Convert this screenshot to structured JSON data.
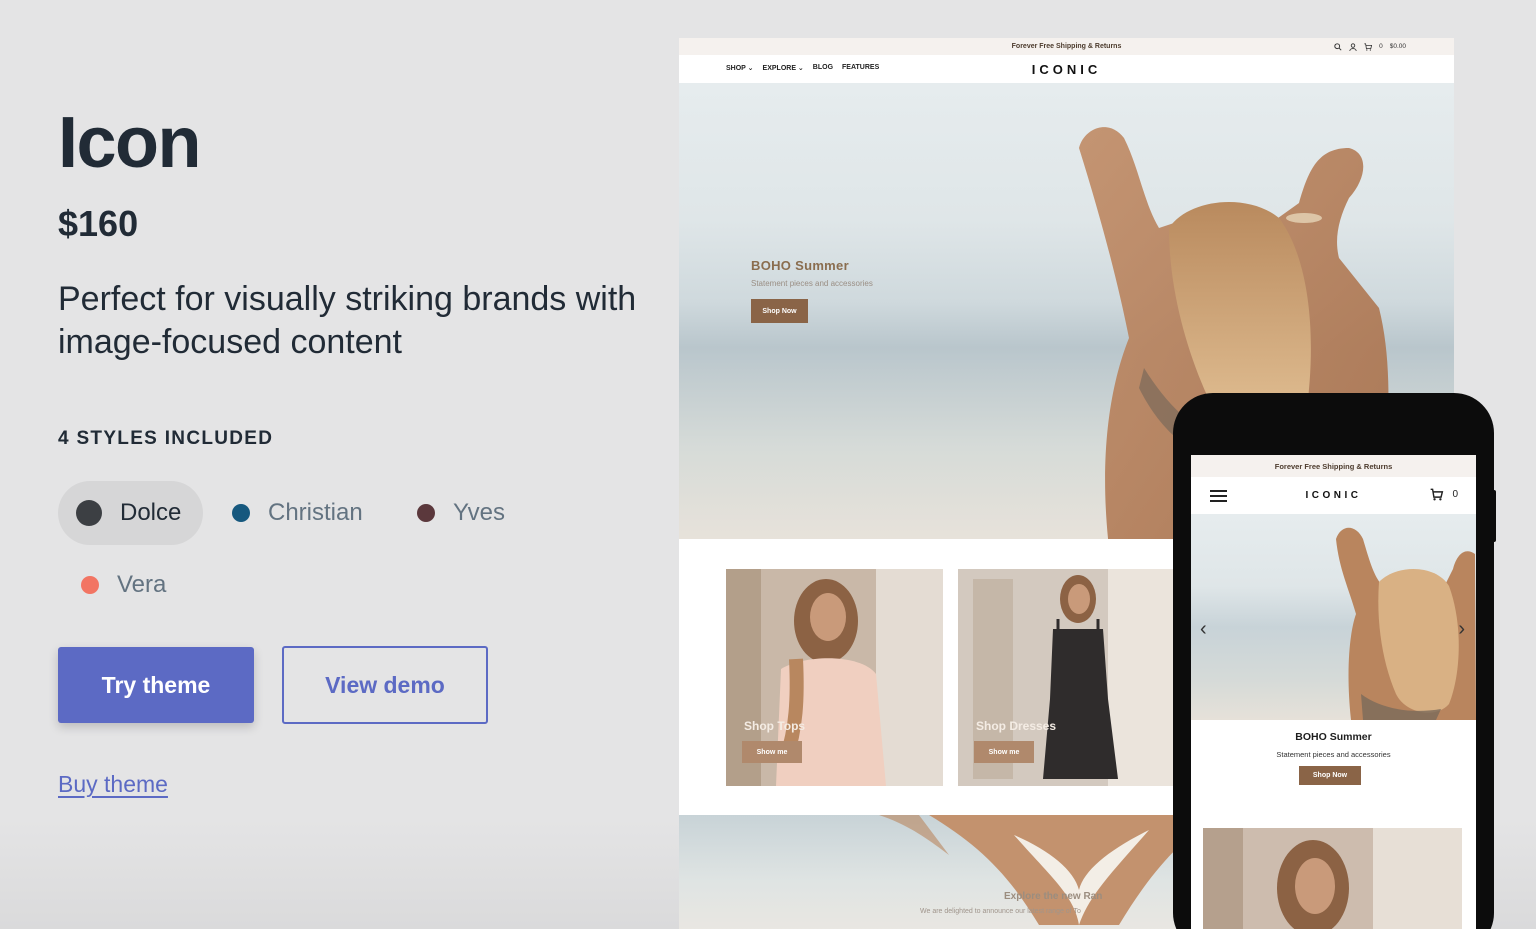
{
  "theme": {
    "name": "Icon",
    "price": "$160",
    "description": "Perfect for visually striking brands with image-focused content",
    "styles_heading": "4 STYLES INCLUDED",
    "styles": [
      {
        "label": "Dolce",
        "color": "#3c3f43",
        "selected": true
      },
      {
        "label": "Christian",
        "color": "#16587e",
        "selected": false
      },
      {
        "label": "Yves",
        "color": "#5b383c",
        "selected": false
      },
      {
        "label": "Vera",
        "color": "#f27563",
        "selected": false
      }
    ],
    "try_label": "Try theme",
    "demo_label": "View demo",
    "buy_label": "Buy theme",
    "accent_color": "#5c6ac4"
  },
  "desktop_preview": {
    "announcement": "Forever Free Shipping & Returns",
    "cart_count": "0",
    "cart_total": "$0.00",
    "nav": [
      "SHOP",
      "EXPLORE",
      "BLOG",
      "FEATURES"
    ],
    "logo": "ICONIC",
    "hero": {
      "title": "BOHO Summer",
      "subtitle": "Statement pieces and accessories",
      "button": "Shop Now"
    },
    "cards": [
      {
        "label": "Shop Tops",
        "button": "Show me"
      },
      {
        "label": "Shop Dresses",
        "button": "Show me"
      }
    ],
    "bottom": {
      "title": "Explore the new Ran",
      "subtitle": "We are delighted to announce our latest range of To"
    }
  },
  "mobile_preview": {
    "announcement": "Forever Free Shipping & Returns",
    "logo": "ICONIC",
    "cart_count": "0",
    "hero_title": "BOHO Summer",
    "hero_subtitle": "Statement pieces and accessories",
    "hero_button": "Shop Now",
    "arrow_prev": "‹",
    "arrow_next": "›"
  }
}
